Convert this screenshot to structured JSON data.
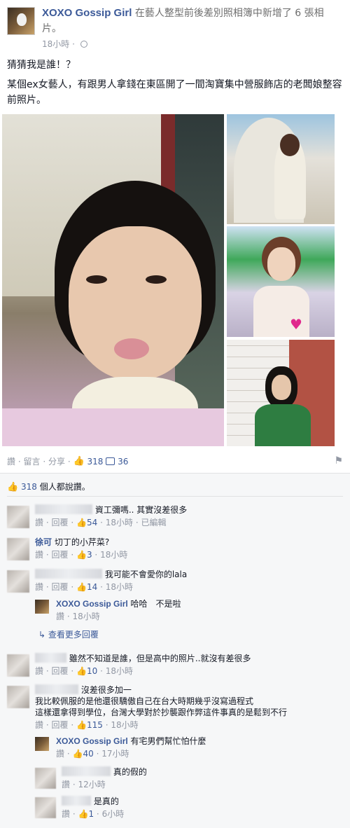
{
  "post": {
    "page_name": "XOXO Gossip Girl",
    "action_text": "在藝人整型前後差別照相簿中新增了 6 張相片。",
    "time": "18小時",
    "dot": "·",
    "text_line1": "猜猜我是誰！？",
    "text_line2": "某個ex女藝人，有跟男人拿錢在東區開了一間淘寶集中營服飾店的老闆娘整容前照片。"
  },
  "actions": {
    "like": "讚",
    "sep": "·",
    "comment": "留言",
    "share": "分享",
    "like_count": "318",
    "comment_count": "36"
  },
  "likes_summary": {
    "count": "318",
    "suffix": "個人都說讚。"
  },
  "labels": {
    "like": "讚",
    "reply": "回覆",
    "dot": "·",
    "edited": "已編輯",
    "more_replies": "查看更多回覆"
  },
  "comments": [
    {
      "name": "",
      "text": "資工彌嗎.. 其實沒差很多",
      "likes": "54",
      "time": "18小時"
    },
    {
      "name": "徐可",
      "text": "切丁的小芹菜?",
      "likes": "3",
      "time": "18小時"
    },
    {
      "name": "",
      "text": "我可能不會愛你的lala",
      "likes": "14",
      "time": "18小時"
    },
    {
      "name": "XOXO Gossip Girl",
      "text": "哈哈　不是啦",
      "time": "18小時"
    },
    {
      "name": "",
      "text": "雖然不知道是誰，但是高中的照片..就沒有差很多",
      "likes": "10",
      "time": "18小時"
    },
    {
      "name": "",
      "text_line1": "沒差很多加一",
      "text_line2": "我比較佩服的是他還很驕傲自己在台大時期幾乎沒寫過程式",
      "text_line3": "這樣還拿得到學位，台灣大學對於抄襲跟作弊這件事真的是鬆到不行",
      "likes": "115",
      "time": "18小時"
    },
    {
      "name": "XOXO Gossip Girl",
      "text": "有宅男們幫忙怕什麼",
      "likes": "40",
      "time": "17小時"
    },
    {
      "name": "",
      "text": "真的假的",
      "time": "12小時"
    },
    {
      "name": "",
      "text": "是真的",
      "likes": "1",
      "time": "6小時"
    }
  ],
  "icons": [
    "globe-icon",
    "thumbs-up-icon",
    "comment-icon",
    "flag-icon",
    "reply-arrow-icon"
  ],
  "colors": {
    "link": "#3b5998",
    "meta": "#9197a3",
    "feedback_bg": "#f6f7f8"
  }
}
